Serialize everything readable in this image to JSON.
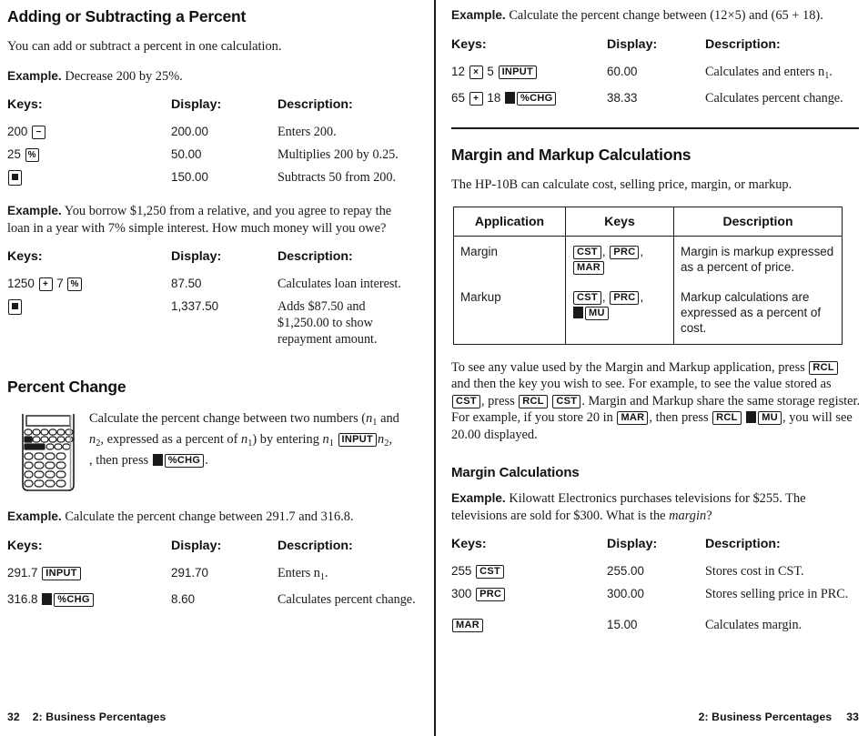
{
  "page": {
    "left_page_number": "32",
    "right_page_number": "33",
    "chapter_footer": "2: Business Percentages"
  },
  "left_column": {
    "section1": {
      "title": "Adding or Subtracting a Percent",
      "intro": "You can add or subtract a percent in one calculation.",
      "example1": {
        "label": "Example.",
        "text": "Decrease 200 by 25%.",
        "headers": {
          "keys": "Keys:",
          "display": "Display:",
          "description": "Description:"
        },
        "rows": [
          {
            "keys_prefix": "200",
            "key1": "−",
            "keys_suffix": "",
            "display": "200.00",
            "description": "Enters 200."
          },
          {
            "keys_prefix": "25",
            "key1": "%",
            "keys_suffix": "",
            "display": "50.00",
            "description": "Multiplies 200 by 0.25."
          },
          {
            "keys_prefix": "",
            "key1": "=",
            "keys_suffix": "",
            "display": "150.00",
            "description": "Subtracts 50 from 200."
          }
        ]
      },
      "example2": {
        "label": "Example.",
        "text": "You borrow $1,250 from a relative, and you agree to repay the loan in a year with 7% simple interest. How much money will you owe?",
        "headers": {
          "keys": "Keys:",
          "display": "Display:",
          "description": "Description:"
        },
        "rows": [
          {
            "keys_prefix": "1250",
            "key1": "+",
            "keys_mid": "7",
            "key2": "%",
            "display": "87.50",
            "description": "Calculates loan interest."
          },
          {
            "keys_prefix": "",
            "key1": "=",
            "keys_mid": "",
            "key2": "",
            "display": "1,337.50",
            "description": "Adds $87.50 and $1,250.00 to show repayment amount."
          }
        ]
      }
    },
    "section2": {
      "title": "Percent Change",
      "illustration_icon": "calculator-keypad-illustration",
      "illustration_text_part1": "Calculate the percent change between two numbers (",
      "illustration_n1": "n",
      "illustration_n1_sub": "1",
      "illustration_text_part2": " and ",
      "illustration_n2": "n",
      "illustration_n2_sub": "2",
      "illustration_text_part3": ", expressed as a percent of ",
      "illustration_text_part4": ") by entering ",
      "illustration_key_input": "INPUT",
      "illustration_text_part5": ", then press ",
      "illustration_key_pctchg": "%CHG",
      "illustration_text_end": ".",
      "example": {
        "label": "Example.",
        "text": "Calculate the percent change between 291.7 and 316.8.",
        "headers": {
          "keys": "Keys:",
          "display": "Display:",
          "description": "Description:"
        },
        "rows": [
          {
            "keys_prefix": "291.7",
            "key1": "INPUT",
            "shift": false,
            "display": "291.70",
            "description_pre": "Enters n",
            "description_sub": "1",
            "description_post": "."
          },
          {
            "keys_prefix": "316.8",
            "key1": "%CHG",
            "shift": true,
            "display": "8.60",
            "description_pre": "Calculates percent change.",
            "description_sub": "",
            "description_post": ""
          }
        ]
      }
    }
  },
  "right_column": {
    "example_top": {
      "label": "Example.",
      "text_part1": "Calculate the percent change between (12",
      "times": "×",
      "text_part2": "5) and (65 + 18).",
      "headers": {
        "keys": "Keys:",
        "display": "Display:",
        "description": "Description:"
      },
      "rows": [
        {
          "n1": "12",
          "key1": "×",
          "n2": "5",
          "key2": "INPUT",
          "shift": false,
          "display": "60.00",
          "description_pre": "Calculates and enters n",
          "description_sub": "1",
          "description_post": "."
        },
        {
          "n1": "65",
          "key1": "+",
          "n2": "18",
          "key2": "%CHG",
          "shift": true,
          "display": "38.33",
          "description_pre": "Calculates percent change.",
          "description_sub": "",
          "description_post": ""
        }
      ]
    },
    "section_margin_markup": {
      "title": "Margin and Markup Calculations",
      "intro": "The HP-10B can calculate cost, selling price, margin, or markup.",
      "table": {
        "headers": [
          "Application",
          "Keys",
          "Description"
        ],
        "rows": [
          {
            "application": "Margin",
            "keys": [
              "CST",
              "PRC",
              "MAR"
            ],
            "keys_shift_last": false,
            "description": "Margin is markup expressed as a percent of price."
          },
          {
            "application": "Markup",
            "keys": [
              "CST",
              "PRC",
              "MU"
            ],
            "keys_shift_last": true,
            "description": "Markup calculations are expressed as a percent of cost."
          }
        ]
      },
      "paragraph": {
        "p1": "To see any value used by the Margin and Markup application, press ",
        "k_rcl_1": "RCL",
        "p2": " and then the key you wish to see. For example, to see the value stored as ",
        "k_cst_1": "CST",
        "p3": ", press ",
        "k_rcl_2": "RCL",
        "k_cst_2": "CST",
        "p4": ". Margin and Markup share the same storage register.  For example, if you store 20 in ",
        "k_mar": "MAR",
        "p5": ", then press ",
        "k_rcl_3": "RCL",
        "k_mu": "MU",
        "p6": ", you will see 20.00 displayed."
      }
    },
    "section_margin_calc": {
      "title": "Margin Calculations",
      "example": {
        "label": "Example.",
        "text_part1": "Kilowatt Electronics purchases televisions for $255. The televisions are sold for $300. What is the ",
        "italic_word": "margin",
        "text_part2": "?",
        "headers": {
          "keys": "Keys:",
          "display": "Display:",
          "description": "Description:"
        },
        "rows": [
          {
            "value": "255",
            "key": "CST",
            "display": "255.00",
            "description": "Stores cost in CST."
          },
          {
            "value": "300",
            "key": "PRC",
            "display": "300.00",
            "description": "Stores selling price in PRC."
          },
          {
            "value": "",
            "key": "MAR",
            "display": "15.00",
            "description": "Calculates margin."
          }
        ]
      }
    }
  },
  "colors": {
    "ink": "#1a1a1a",
    "paper": "#ffffff"
  }
}
